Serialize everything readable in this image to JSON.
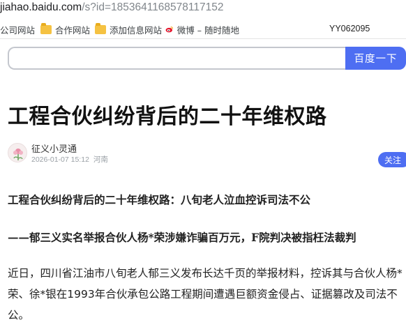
{
  "browser": {
    "url_host": "jiahao.baidu.com",
    "url_path": "/s?id=1853641168578117152"
  },
  "bookmarks": {
    "items": [
      {
        "label": "公司网站",
        "icon": "none"
      },
      {
        "label": "合作网站",
        "icon": "folder-icon"
      },
      {
        "label": "添加信息网站",
        "icon": "folder-icon"
      },
      {
        "label": "微博 – 随时随地",
        "icon": "weibo-icon"
      }
    ],
    "right_label": "YY062095"
  },
  "search": {
    "placeholder": "",
    "button_label": "百度一下",
    "accent": "#4e6ef2"
  },
  "article": {
    "title": "工程合伙纠纷背后的二十年维权路",
    "author": "征义小灵通",
    "date": "2026-01-07 15:12",
    "location": "河南",
    "follow_label": "关注",
    "heading_line": "工程合伙纠纷背后的二十年维权路：八旬老人泣血控诉司法不公",
    "subheading_line": "——郁三义实名举报合伙人杨*荣涉嫌诈骗百万元，F院判决被指枉法裁判",
    "body_lines": [
      "近日，四川省江油市八旬老人郁三义发布长达千页的举报材料，控诉其与合伙人杨*",
      "荣、徐*银在1993年合伙承包公路工程期间遭遇巨额资金侵占、证据篡改及司法不",
      "公。"
    ]
  }
}
